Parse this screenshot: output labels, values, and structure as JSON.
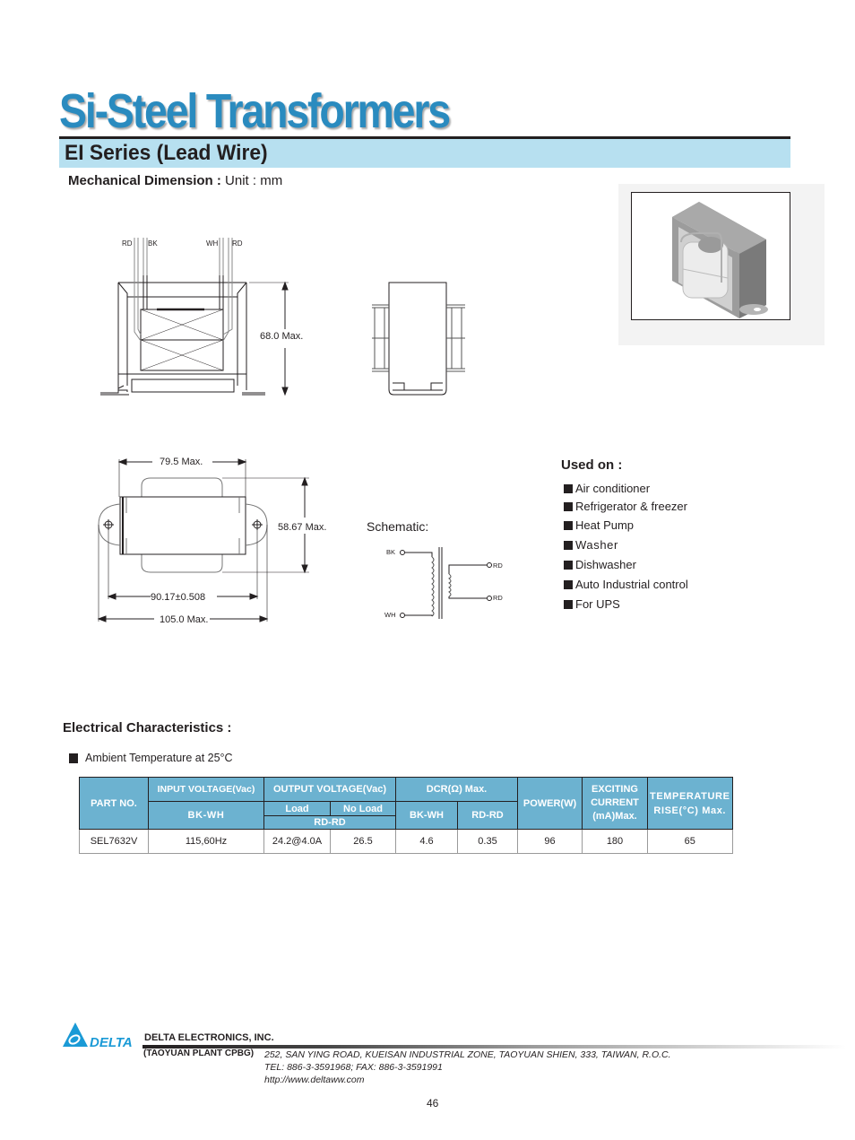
{
  "header": {
    "title": "Si-Steel Transformers",
    "series_title": "EI Series (Lead Wire)",
    "mech_label_bold": "Mechanical Dimension : ",
    "mech_label_unit": "Unit : mm"
  },
  "drawings": {
    "side_view": {
      "lead_labels": [
        "RD",
        "BK",
        "WH",
        "RD"
      ],
      "height_dim": "68.0 Max."
    },
    "bottom_view": {
      "width_dim": "79.5 Max.",
      "height_dim": "58.67 Max.",
      "hole_spacing_dim": "90.17±0.508",
      "overall_dim": "105.0 Max."
    }
  },
  "schematic": {
    "label": "Schematic:",
    "primary_top": "BK",
    "primary_bottom": "WH",
    "secondary_top": "RD",
    "secondary_bottom": "RD"
  },
  "used_on": {
    "title": "Used on :",
    "items": [
      "Air conditioner",
      "Refrigerator & freezer",
      "Heat Pump",
      "Washer",
      "Dishwasher",
      "Auto Industrial control",
      "For UPS"
    ]
  },
  "electrical": {
    "title": "Electrical Characteristics :",
    "ambient": "Ambient Temperature at 25°C",
    "table": {
      "headers": {
        "part_no": "PART NO.",
        "input_voltage": "INPUT VOLTAGE(Vac)",
        "input_sub": "BK-WH",
        "output_voltage": "OUTPUT VOLTAGE(Vac)",
        "output_load": "Load",
        "output_no_load": "No Load",
        "output_sub": "RD-RD",
        "dcr": "DCR(Ω) Max.",
        "dcr_bkwh": "BK-WH",
        "dcr_rdrd": "RD-RD",
        "power": "POWER(W)",
        "exciting_1": "EXCITING",
        "exciting_2": "CURRENT",
        "exciting_3": "(mA)Max.",
        "temp_1": "TEMPERATURE",
        "temp_2": "RISE(°C) Max."
      },
      "rows": [
        {
          "part_no": "SEL7632V",
          "input": "115,60Hz",
          "output_load": "24.2@4.0A",
          "output_no_load": "26.5",
          "dcr_bkwh": "4.6",
          "dcr_rdrd": "0.35",
          "power": "96",
          "exciting_current": "180",
          "temp_rise": "65"
        }
      ]
    }
  },
  "footer": {
    "logo_text": "DELTA",
    "company": "DELTA ELECTRONICS, INC.",
    "plant": "(TAOYUAN PLANT CPBG)",
    "address": "252, SAN YING ROAD, KUEISAN INDUSTRIAL ZONE, TAOYUAN SHIEN, 333, TAIWAN, R.O.C.",
    "phone": "TEL: 886-3-3591968; FAX: 886-3-3591991",
    "website": "http://www.deltaww.com",
    "page_number": "46"
  },
  "colors": {
    "title_blue": "#2a8bbf",
    "series_bar": "#b7e0f0",
    "table_header": "#6cb2d0",
    "delta_blue": "#1a9ad6"
  }
}
